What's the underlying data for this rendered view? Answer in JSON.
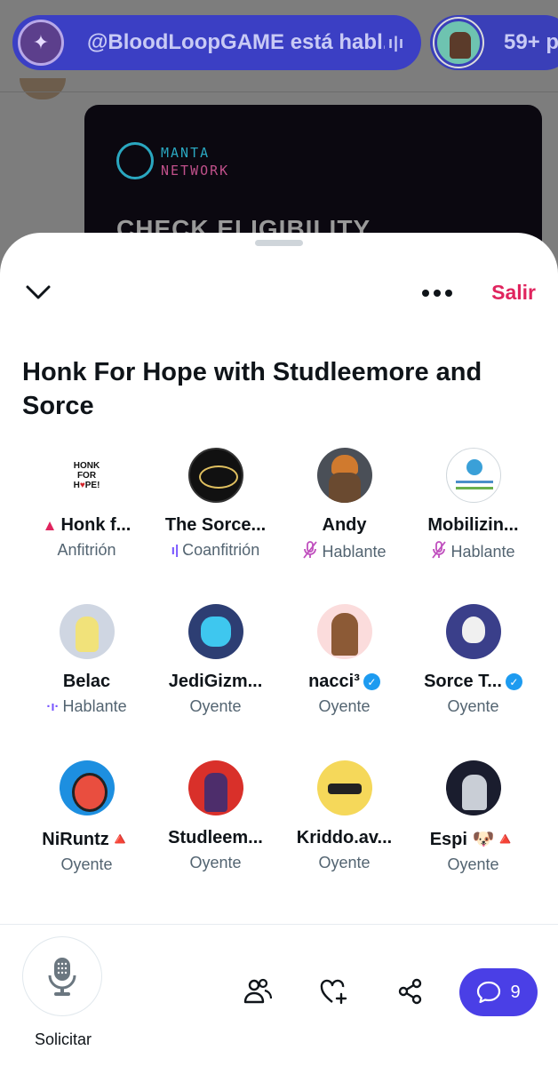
{
  "background": {
    "banner_logo_line1": "MANTA",
    "banner_logo_line2": "NETWORK",
    "banner_text": "CHECK ELIGIBILITY"
  },
  "top_bar": {
    "space_pill_text": "@BloodLoopGAME está habl...",
    "second_pill_count": "59+ p"
  },
  "sheet": {
    "exit_label": "Salir",
    "title": "Honk For Hope with Studleemore and Sorce"
  },
  "participants": [
    {
      "name": "Honk f...",
      "prefix": "🔺",
      "role": "Anfitrión",
      "role_icon": "",
      "verified": false
    },
    {
      "name": "The Sorce...",
      "prefix": "",
      "role": "Coanfitrión",
      "role_icon": "speaking-wave-icon",
      "verified": false
    },
    {
      "name": "Andy",
      "prefix": "",
      "role": "Hablante",
      "role_icon": "mic-muted-icon",
      "verified": false
    },
    {
      "name": "Mobilizin...",
      "prefix": "",
      "role": "Hablante",
      "role_icon": "mic-muted-icon",
      "verified": false
    },
    {
      "name": "Belac",
      "prefix": "",
      "role": "Hablante",
      "role_icon": "speaking-wave-icon",
      "verified": false
    },
    {
      "name": "JediGizm...",
      "prefix": "",
      "role": "Oyente",
      "role_icon": "",
      "verified": false
    },
    {
      "name": "nacci³",
      "prefix": "",
      "role": "Oyente",
      "role_icon": "",
      "verified": true
    },
    {
      "name": "Sorce T...",
      "prefix": "",
      "role": "Oyente",
      "role_icon": "",
      "verified": true
    },
    {
      "name": "NiRuntz🔺",
      "prefix": "",
      "role": "Oyente",
      "role_icon": "",
      "verified": false
    },
    {
      "name": "Studleem...",
      "prefix": "",
      "role": "Oyente",
      "role_icon": "",
      "verified": false
    },
    {
      "name": "Kriddo.av...",
      "prefix": "",
      "role": "Oyente",
      "role_icon": "",
      "verified": false
    },
    {
      "name": "Espi 🐶🔺",
      "prefix": "",
      "role": "Oyente",
      "role_icon": "",
      "verified": false
    }
  ],
  "honk_avatar_text": "HONK FOR HOPE!",
  "bottom_bar": {
    "request_label": "Solicitar",
    "chat_count": "9"
  },
  "colors": {
    "exit": "#e0245e",
    "accent": "#4a3fe6",
    "verified": "#1d9bf0",
    "speaking": "#7856ff"
  }
}
